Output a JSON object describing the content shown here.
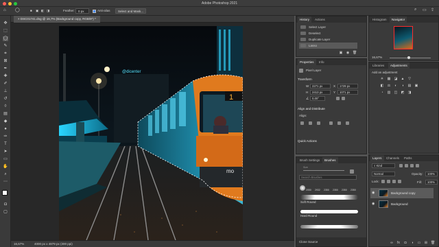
{
  "window": {
    "title": "Adobe Photoshop 2021"
  },
  "options_bar": {
    "feather_label": "Feather:",
    "feather_value": "0 px",
    "antialias_label": "Anti-alias",
    "select_mask_label": "Select and Mask..."
  },
  "document": {
    "tab_title": "DSC01741.dng @ 16,7% (Background copy, RGB/8*) *",
    "zoom": "16,67%",
    "info": "4000 px x 4879 px (300 ppi)"
  },
  "history": {
    "tabs": [
      "History",
      "Actions"
    ],
    "items": [
      {
        "label": "Select Layer"
      },
      {
        "label": "Deselect"
      },
      {
        "label": "Duplicate Layer"
      },
      {
        "label": "Lasso"
      }
    ]
  },
  "navigator": {
    "tabs": [
      "Histogram",
      "Navigator"
    ],
    "zoom": "16,67%"
  },
  "adjustments": {
    "tabs": [
      "Libraries",
      "Adjustments"
    ],
    "hint": "Add an adjustment",
    "icons": [
      "☀",
      "▦",
      "◪",
      "▲",
      "▽",
      "◧",
      "⚖",
      "◐",
      "◑",
      "▤",
      "▣",
      "◔",
      "▥",
      "◫",
      "◩",
      "◨"
    ]
  },
  "properties": {
    "tabs": [
      "Properties",
      "Info"
    ],
    "layer_type": "Pixel Layer",
    "transform_label": "Transform",
    "w": "2271 px",
    "h": "2413 px",
    "x": "1729 px",
    "y": "1071 px",
    "angle": "0,00°",
    "align_label": "Align and Distribute",
    "align_sub": "Align:",
    "quick_actions": "Quick Actions"
  },
  "brushes": {
    "tabs": [
      "Brush Settings",
      "Brushes"
    ],
    "search_placeholder": "Search Brushes",
    "sizes": [
      "2050",
      "2932",
      "2350",
      "2350",
      "2350",
      "2350",
      "2350"
    ],
    "items": [
      {
        "name": "Soft Round"
      },
      {
        "name": "Hard Round"
      }
    ],
    "bottom": "Clone Source"
  },
  "layers": {
    "tabs": [
      "Layers",
      "Channels",
      "Paths"
    ],
    "kind": "Kind",
    "blend": "Normal",
    "opacity_label": "Opacity:",
    "opacity": "100%",
    "lock_label": "Lock:",
    "fill_label": "Fill:",
    "fill": "100%",
    "rows": [
      {
        "name": "Background copy",
        "active": true
      },
      {
        "name": "Background",
        "active": false
      }
    ]
  }
}
